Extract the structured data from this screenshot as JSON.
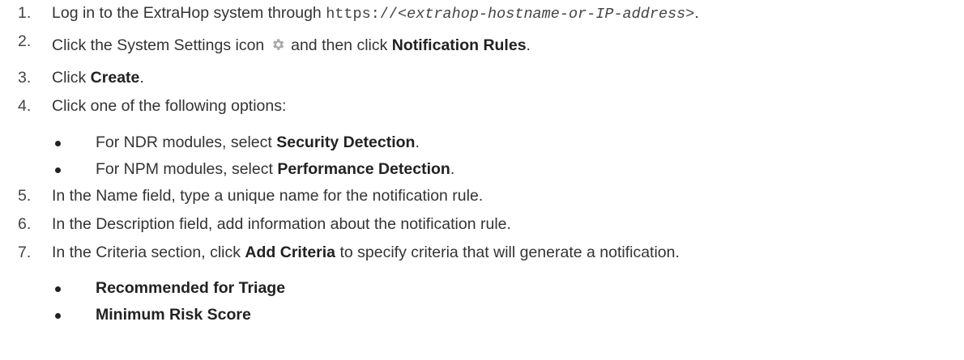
{
  "steps": [
    {
      "num": "1.",
      "before": "Log in to the ExtraHop system through ",
      "url_prefix": "https://",
      "url_var": "<extrahop-hostname-or-IP-address>",
      "after": "."
    },
    {
      "num": "2.",
      "before": "Click the System Settings icon",
      "middle": " and then click ",
      "bold": "Notification Rules",
      "after": "."
    },
    {
      "num": "3.",
      "before": "Click ",
      "bold": "Create",
      "after": "."
    },
    {
      "num": "4.",
      "text": "Click one of the following options:",
      "options": [
        {
          "before": "For NDR modules, select ",
          "bold": "Security Detection",
          "after": "."
        },
        {
          "before": "For NPM modules, select ",
          "bold": "Performance Detection",
          "after": "."
        }
      ]
    },
    {
      "num": "5.",
      "text": "In the Name field, type a unique name for the notification rule."
    },
    {
      "num": "6.",
      "text": "In the Description field, add information about the notification rule."
    },
    {
      "num": "7.",
      "before": "In the Criteria section, click ",
      "bold": "Add Criteria",
      "after": " to specify criteria that will generate a notification.",
      "criteria": [
        "Recommended for Triage",
        "Minimum Risk Score"
      ]
    }
  ],
  "icons": {
    "gear": "gear-icon"
  },
  "colors": {
    "text": "#333333",
    "gear": "#a9a9a9"
  }
}
